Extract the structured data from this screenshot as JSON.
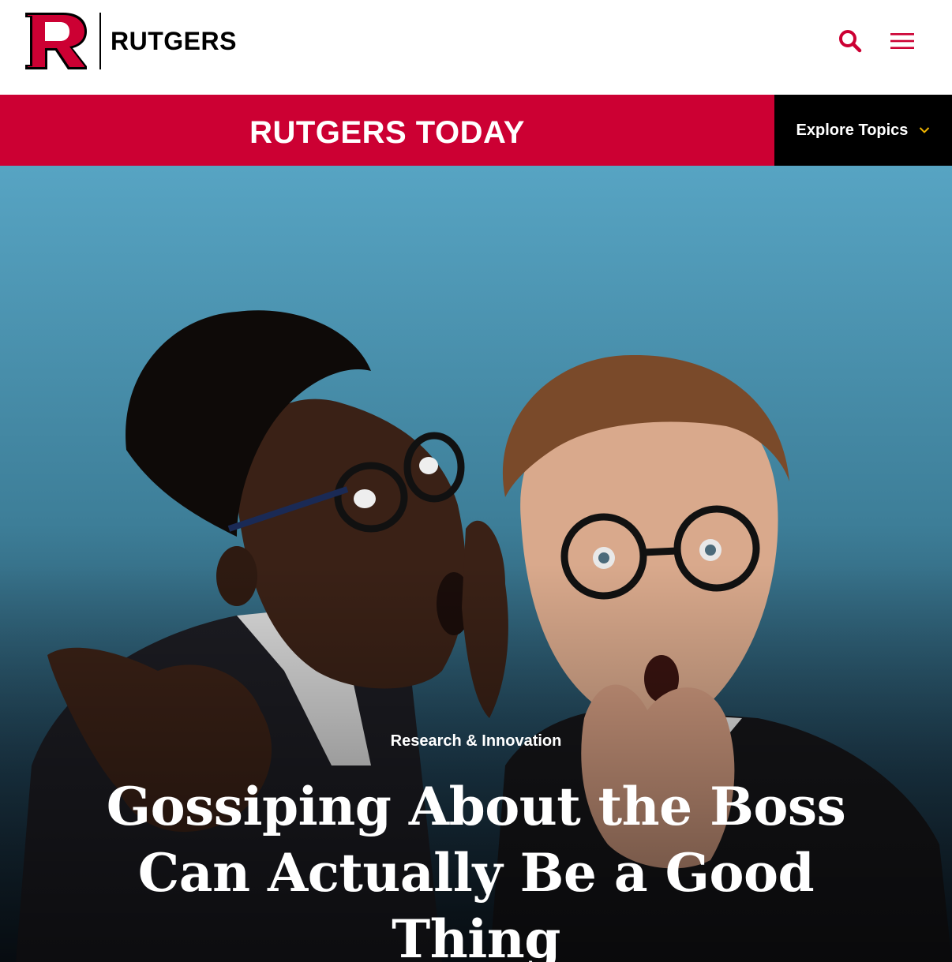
{
  "brand": {
    "wordmark": "RUTGERS",
    "logo_letter": "R",
    "color_red": "#cc0033",
    "color_black": "#000000"
  },
  "header": {
    "search_icon": "search-icon",
    "menu_icon": "hamburger-menu-icon"
  },
  "section_bar": {
    "title": "RUTGERS TODAY",
    "explore_label": "Explore Topics",
    "explore_icon": "chevron-down-icon",
    "explore_icon_color": "#f0b400"
  },
  "hero": {
    "category": "Research & Innovation",
    "headline": "Gossiping About the Boss Can Actually Be a Good Thing",
    "background_top": "#57a4c3",
    "background_bottom": "#0f1a24"
  }
}
